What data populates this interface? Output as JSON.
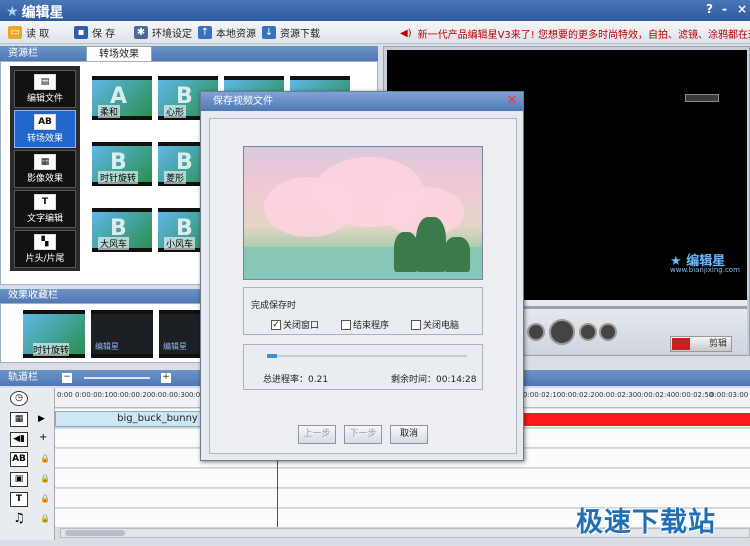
{
  "app": {
    "name": "编辑星",
    "window_buttons": [
      "?",
      "-",
      "×"
    ]
  },
  "toolbar": {
    "items": [
      {
        "label": "读  取",
        "icon": "folder-open-icon"
      },
      {
        "label": "保  存",
        "icon": "save-icon"
      },
      {
        "label": "环境设定",
        "icon": "gear-icon"
      },
      {
        "label": "本地资源",
        "icon": "upload-icon"
      },
      {
        "label": "资源下载",
        "icon": "download-icon"
      }
    ],
    "notice": "新一代产品编辑星V3来了! 您想要的更多时尚特效，自拍、滤镜、涂鸦都在这里!"
  },
  "resource_panel": {
    "header": "资源栏",
    "active_tab": "转场效果",
    "sidebar": [
      {
        "label": "编辑文件",
        "icon": "film-icon",
        "active": false
      },
      {
        "label": "转场效果",
        "icon": "ab-transition-icon",
        "active": true
      },
      {
        "label": "影像效果",
        "icon": "film-effect-icon",
        "active": false
      },
      {
        "label": "文字编辑",
        "icon": "text-icon",
        "active": false
      },
      {
        "label": "片头/片尾",
        "icon": "blocks-icon",
        "active": false
      }
    ],
    "thumbnails": [
      "柔和",
      "心形",
      "时针旋转",
      "菱形",
      "大风车",
      "小风车"
    ]
  },
  "effects_panel": {
    "header": "效果收藏栏",
    "items": [
      "时针旋转",
      "编辑星",
      "编辑星"
    ]
  },
  "preview": {
    "logo": "编辑星",
    "url": "www.bianjixing.com",
    "cut_label": "剪辑"
  },
  "track_panel": {
    "header": "轨道栏",
    "ruler_ticks": [
      "0:00",
      "0:00:00:10",
      "0:00:00:20",
      "0:00:00:30",
      "0:00:00:40",
      "0:00:02:10",
      "0:00:02:20",
      "0:00:02:30",
      "0:00:02:40",
      "0:00:02:50",
      "0:00:03:00"
    ],
    "clip_label": "big_buck_bunny"
  },
  "dialog": {
    "title": "保存视频文件",
    "options_title": "完成保存时",
    "options": [
      {
        "label": "关闭窗口",
        "checked": true
      },
      {
        "label": "结束程序",
        "checked": false
      },
      {
        "label": "关闭电脑",
        "checked": false
      }
    ],
    "progress_fraction": 0.05,
    "total_progress": "总进程率：0.21",
    "remaining_time": "剩余时间：00:14:28",
    "buttons": {
      "prev": "上一步",
      "next": "下一步",
      "cancel": "取消"
    }
  },
  "watermark": "极速下载站"
}
